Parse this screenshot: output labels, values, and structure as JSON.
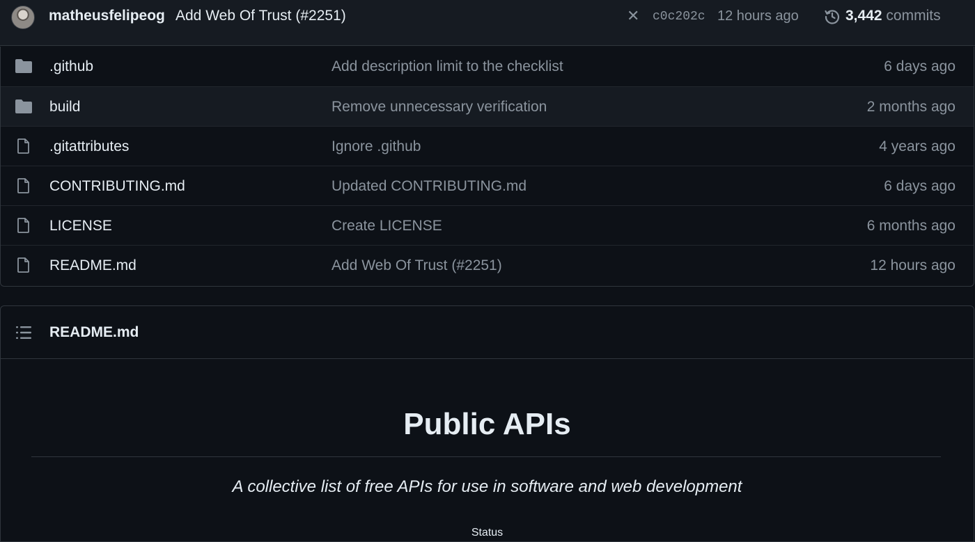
{
  "latest_commit": {
    "author": "matheusfelipeog",
    "message": "Add Web Of Trust (#2251)",
    "status_icon": "x-icon",
    "sha": "c0c202c",
    "time": "12 hours ago",
    "commit_count": "3,442",
    "commit_label": " commits"
  },
  "files": [
    {
      "type": "folder",
      "name": ".github",
      "message": "Add description limit to the checklist",
      "time": "6 days ago"
    },
    {
      "type": "folder",
      "name": "build",
      "message": "Remove unnecessary verification",
      "time": "2 months ago"
    },
    {
      "type": "file",
      "name": ".gitattributes",
      "message": "Ignore .github",
      "time": "4 years ago"
    },
    {
      "type": "file",
      "name": "CONTRIBUTING.md",
      "message": "Updated CONTRIBUTING.md",
      "time": "6 days ago"
    },
    {
      "type": "file",
      "name": "LICENSE",
      "message": "Create LICENSE",
      "time": "6 months ago"
    },
    {
      "type": "file",
      "name": "README.md",
      "message": "Add Web Of Trust (#2251)",
      "time": "12 hours ago"
    }
  ],
  "readme": {
    "filename": "README.md",
    "heading": "Public APIs",
    "tagline": "A collective list of free APIs for use in software and web development",
    "status_label": "Status"
  },
  "colors": {
    "background": "#0d1117",
    "panel": "#161b22",
    "border": "#30363d",
    "text": "#e6edf3",
    "muted": "#8b949e"
  }
}
